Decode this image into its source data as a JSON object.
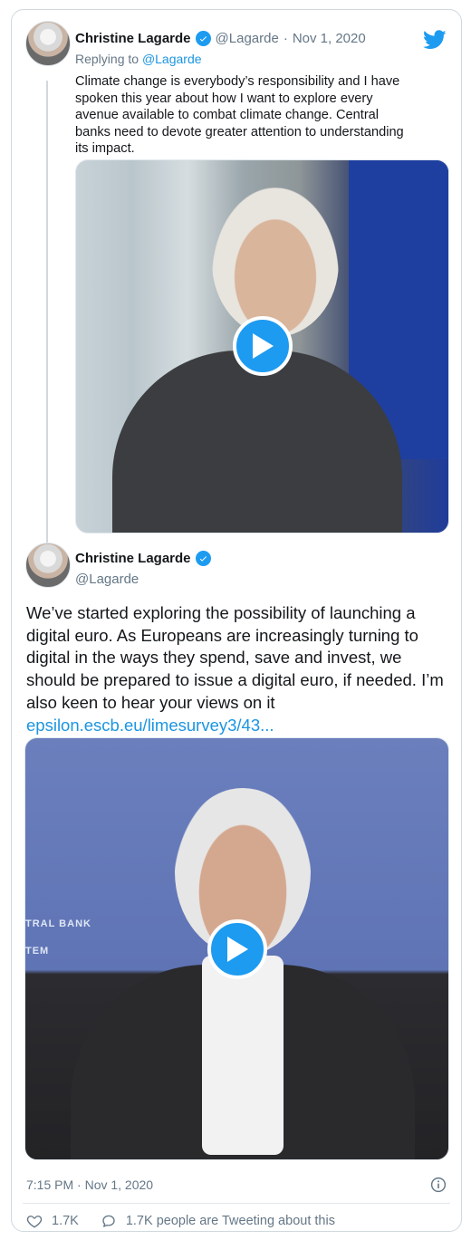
{
  "reply_tweet": {
    "author_name": "Christine Lagarde",
    "handle": "@Lagarde",
    "separator": "·",
    "date": "Nov 1, 2020",
    "replying_prefix": "Replying to ",
    "replying_to": "@Lagarde",
    "text": "Climate change is everybody’s responsibility and I have\nspoken this year about how I want to explore every\navenue available to combat climate change. Central\nbanks need to devote greater attention to understanding\nits impact."
  },
  "main_tweet": {
    "author_name": "Christine Lagarde",
    "handle": "@Lagarde",
    "text": "We’ve started exploring the possibility of launching a digital euro. As Europeans are increasingly turning to digital in the ways they spend, save and invest, we should be prepared to issue a digital euro, if needed. I’m also keen to hear your views on it ",
    "link_text": "epsilon.escb.eu/limesurvey3/43...",
    "video_background_text": "TRAL BANK\nTEM",
    "timestamp": "7:15 PM · Nov 1, 2020"
  },
  "actions": {
    "likes": "1.7K",
    "retweets_text": "1.7K people are Tweeting about this"
  },
  "colors": {
    "accent": "#1d9bf0",
    "link": "#1b95e0",
    "muted": "#657786",
    "border": "#cfd9de"
  },
  "icons": [
    "verified-badge-icon",
    "twitter-bird-icon",
    "play-icon",
    "info-icon",
    "heart-icon",
    "comment-icon"
  ]
}
